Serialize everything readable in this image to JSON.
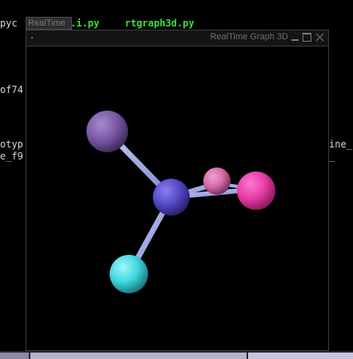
{
  "terminal": {
    "frag_pyc": "pyc",
    "frag_i_py": ".i.py",
    "frag_rtgraph": "rtgraph3d.py",
    "frag_of74": "of74",
    "frag_otyp": "otyp",
    "frag_e_f9": "e_f9",
    "frag_ine": "ine_",
    "frag_right_underscore": "_"
  },
  "background_window_tab": {
    "label": "RealTime"
  },
  "window": {
    "title": "RealTime Graph 3D",
    "buttons": {
      "minimize": "minimize",
      "maximize": "maximize",
      "close": "close"
    }
  },
  "scene": {
    "nodes": [
      {
        "name": "node-purple",
        "color": "#7a5aa6"
      },
      {
        "name": "node-center",
        "color": "#5548c8"
      },
      {
        "name": "node-pink",
        "color": "#d66aa8"
      },
      {
        "name": "node-magenta",
        "color": "#e83ca8"
      },
      {
        "name": "node-cyan",
        "color": "#3fd8e0"
      }
    ],
    "edge_color": "#9ea8e0",
    "background": "#000000"
  }
}
